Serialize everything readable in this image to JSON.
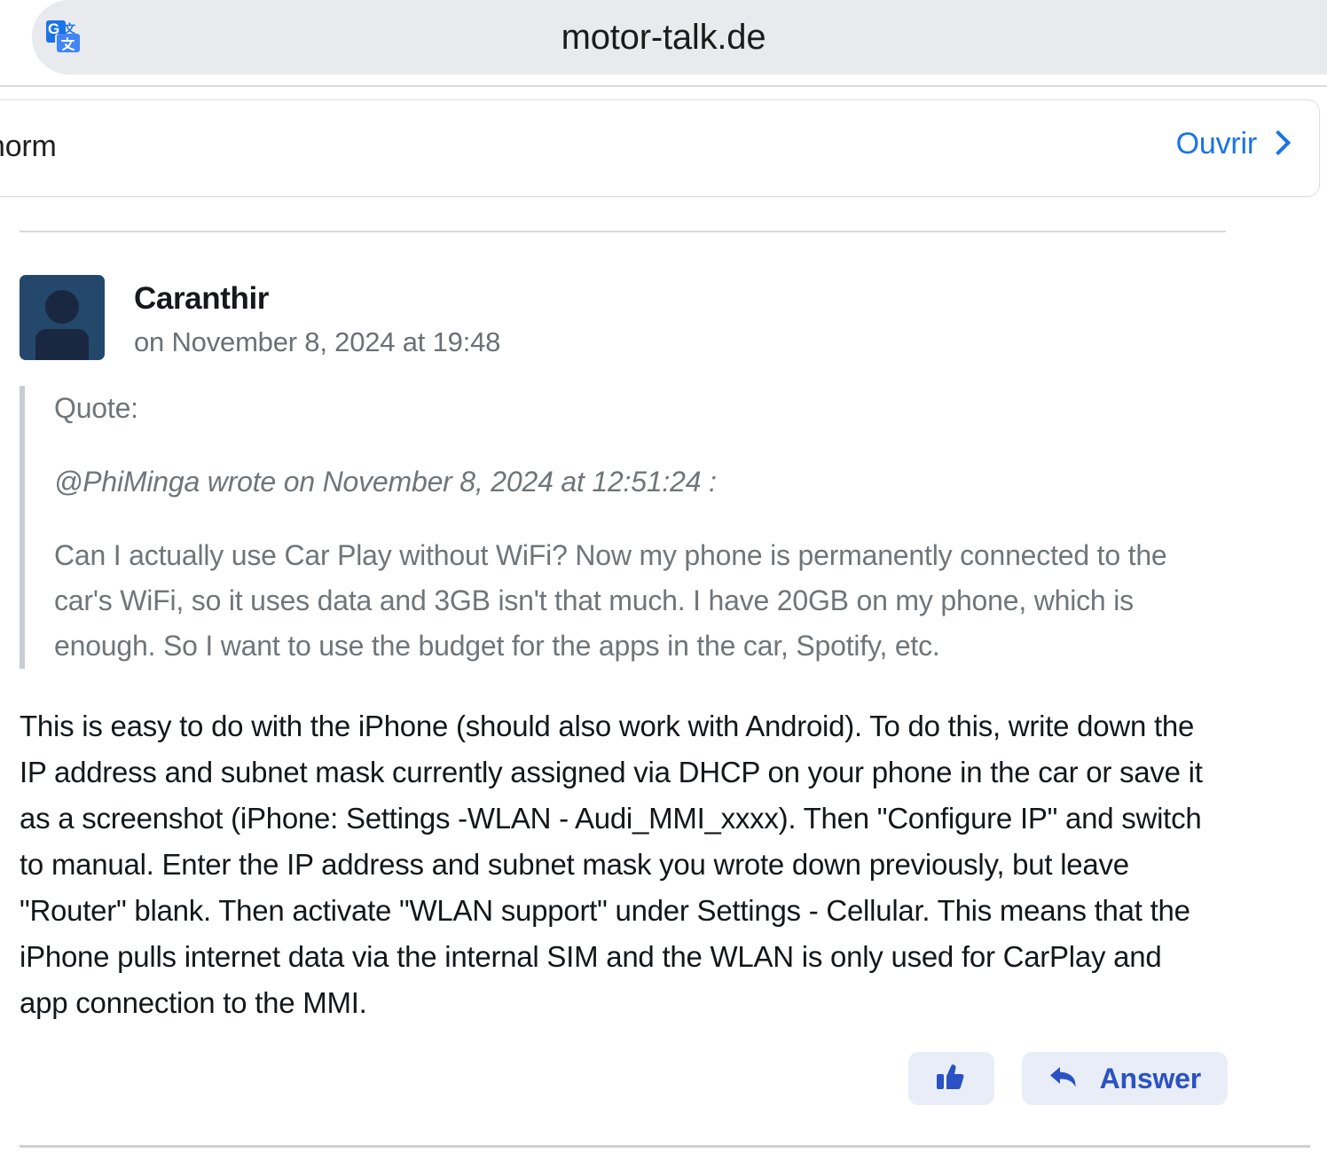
{
  "topbar": {
    "title": "motor-talk.de",
    "translate_icon": "google-translate-icon"
  },
  "banner": {
    "text": "norm",
    "open_label": "Ouvrir",
    "chevron_icon": "chevron-right-icon"
  },
  "post": {
    "author": "Caranthir",
    "date": "on November 8, 2024 at 19:48",
    "avatar_icon": "user-avatar-icon",
    "quote": {
      "label": "Quote:",
      "attribution": "@PhiMinga wrote on November 8, 2024 at 12:51:24 :",
      "body": "Can I actually use Car Play without WiFi? Now my phone is permanently connected to the car's WiFi, so it uses data and 3GB isn't that much. I have 20GB on my phone, which is enough. So I want to use the budget for the apps in the car, Spotify, etc."
    },
    "body": "This is easy to do with the iPhone (should also work with Android). To do this, write down the IP address and subnet mask currently assigned via DHCP on your phone in the car or save it as a screenshot (iPhone: Settings -WLAN - Audi_MMI_xxxx). Then \"Configure IP\" and switch to manual. Enter the IP address and subnet mask you wrote down previously, but leave \"Router\" blank. Then activate \"WLAN support\" under Settings - Cellular. This means that the iPhone pulls internet data via the internal SIM and the WLAN is only used for CarPlay and app connection to the MMI.",
    "actions": {
      "like_icon": "thumbs-up-icon",
      "answer_icon": "reply-arrow-icon",
      "answer_label": "Answer"
    }
  },
  "colors": {
    "link_blue": "#1a73e8",
    "action_blue": "#2b52c4",
    "action_bg": "#e9edf7",
    "topbar_bg": "#e8eaed",
    "avatar_bg": "#24486b",
    "muted_text": "#707579"
  }
}
